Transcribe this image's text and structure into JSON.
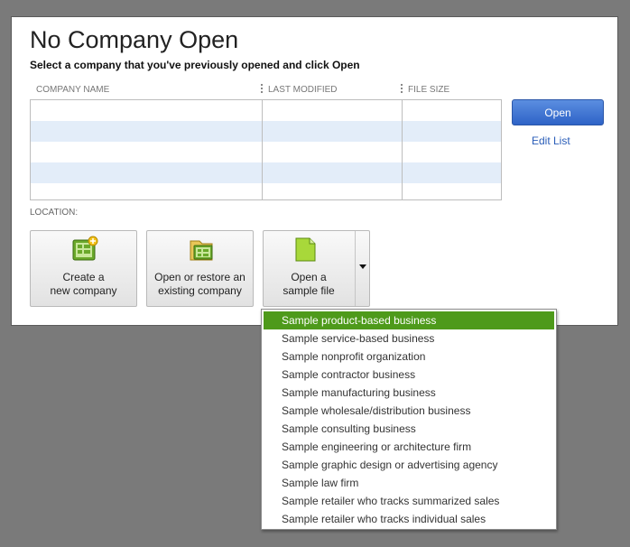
{
  "dialog": {
    "title": "No Company Open",
    "subtitle": "Select a company that you've previously opened and click Open"
  },
  "table": {
    "columns": [
      "COMPANY NAME",
      "LAST MODIFIED",
      "FILE SIZE"
    ],
    "rows": []
  },
  "actions": {
    "open_label": "Open",
    "edit_list_label": "Edit List"
  },
  "location_label": "LOCATION:",
  "buttons": {
    "create": {
      "line1": "Create a",
      "line2": "new company",
      "icon": "create-company-icon"
    },
    "restore": {
      "line1": "Open or restore an",
      "line2": "existing company",
      "icon": "open-restore-icon"
    },
    "sample": {
      "line1": "Open a",
      "line2": "sample file",
      "icon": "sample-file-icon"
    }
  },
  "sample_menu": {
    "selected_index": 0,
    "items": [
      "Sample product-based business",
      "Sample service-based business",
      "Sample nonprofit organization",
      "Sample contractor business",
      "Sample manufacturing business",
      "Sample wholesale/distribution business",
      "Sample consulting business",
      "Sample engineering or architecture firm",
      "Sample graphic design or advertising agency",
      "Sample law firm",
      "Sample retailer who tracks summarized sales",
      "Sample retailer who tracks individual sales"
    ]
  },
  "colors": {
    "open_button": "#2e63c7",
    "link": "#2a5db8",
    "menu_highlight": "#4e9a1b",
    "row_alt": "#e3edf9"
  }
}
